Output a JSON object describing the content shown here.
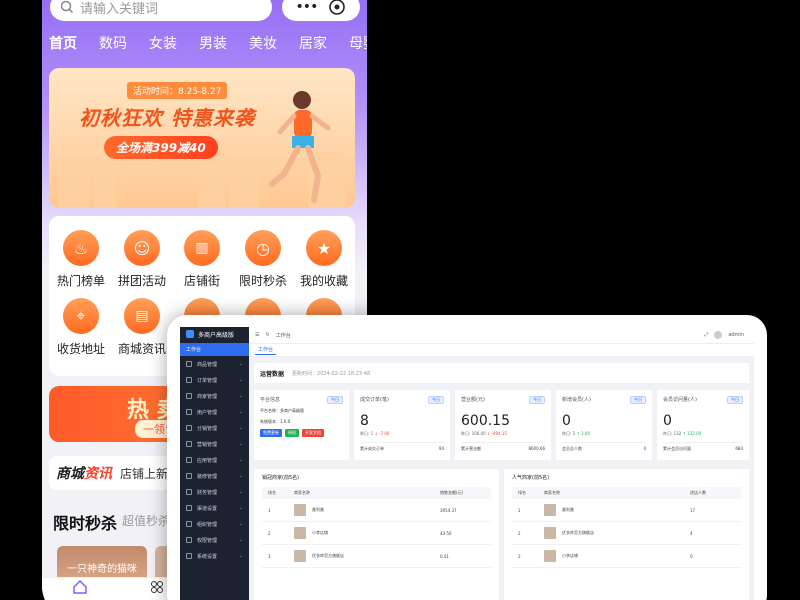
{
  "phone": {
    "search_placeholder": "请输入关键词",
    "categories": [
      "首页",
      "数码",
      "女装",
      "男装",
      "美妆",
      "居家",
      "母婴"
    ],
    "banner": {
      "date": "活动时间：8.25-8.27",
      "headline": "初秋狂欢 特惠来袭",
      "promo": "全场满399减40"
    },
    "menu": [
      "热门榜单",
      "拼团活动",
      "店铺街",
      "限时秒杀",
      "我的收藏",
      "收货地址",
      "商城资讯"
    ],
    "hot_banner": {
      "title": "热 卖",
      "sub": "一领专属"
    },
    "news": {
      "logo_a": "商城",
      "logo_b": "资讯",
      "text": "店铺上新,"
    },
    "flash": {
      "title": "限时秒杀",
      "subtitle": "超值秒杀"
    },
    "flash_card": "一只神奇的猫咪"
  },
  "admin": {
    "brand": "多商户高级版",
    "sidebar": [
      "工作台",
      "商品管理",
      "订单管理",
      "商家管理",
      "用户管理",
      "分销管理",
      "营销管理",
      "应用管理",
      "装修管理",
      "财务管理",
      "渠道设置",
      "组织管理",
      "权限管理",
      "系统设置"
    ],
    "breadcrumb": "工作台",
    "user": "admin",
    "tab": "工作台",
    "ops_title": "运营数据",
    "ops_time": "更新时间：2024-02-22 18:23:48",
    "tag": "今日",
    "platform": {
      "label": "平台信息",
      "name": "平台名称：多商户高级版",
      "version": "系统版本：1.0.0",
      "buttons": [
        "免费更新",
        "授权",
        "开发文档"
      ]
    },
    "stats": [
      {
        "label": "成交订单(笔)",
        "value": "8",
        "yesterday": "昨日: 1",
        "change": "↓ -7.00",
        "change_dir": "dn",
        "footer_label": "累计成交订单",
        "footer_value": "94"
      },
      {
        "label": "营业额(元)",
        "value": "600.15",
        "yesterday": "昨日: 106.00",
        "change": "↓ -494.15",
        "change_dir": "dn",
        "footer_label": "累计营业额",
        "footer_value": "8600.66"
      },
      {
        "label": "新增会员(人)",
        "value": "0",
        "yesterday": "昨日: 2",
        "change": "↑ 2.00",
        "change_dir": "up",
        "footer_label": "会员总人数",
        "footer_value": "0"
      },
      {
        "label": "会员访问量(人)",
        "value": "0",
        "yesterday": "昨日: 132",
        "change": "↑ 132.00",
        "change_dir": "up",
        "footer_label": "累计会员访问量",
        "footer_value": "684"
      }
    ],
    "sales_rank": {
      "title": "销冠商家(前5名)",
      "headers": [
        "排名",
        "商家名称",
        "销售金额(元)"
      ],
      "rows": [
        {
          "rank": "1",
          "name": "美利美",
          "value": "3954.37"
        },
        {
          "rank": "2",
          "name": "小李店铺",
          "value": "43.50"
        },
        {
          "rank": "3",
          "name": "优衣库官方旗舰店",
          "value": "0.01"
        }
      ]
    },
    "popular_rank": {
      "title": "人气商家(前5名)",
      "headers": [
        "排名",
        "商家名称",
        "进店人数"
      ],
      "rows": [
        {
          "rank": "1",
          "name": "美利美",
          "value": "17"
        },
        {
          "rank": "2",
          "name": "优衣库官方旗舰店",
          "value": "4"
        },
        {
          "rank": "3",
          "name": "小李店铺",
          "value": "0"
        }
      ]
    }
  }
}
